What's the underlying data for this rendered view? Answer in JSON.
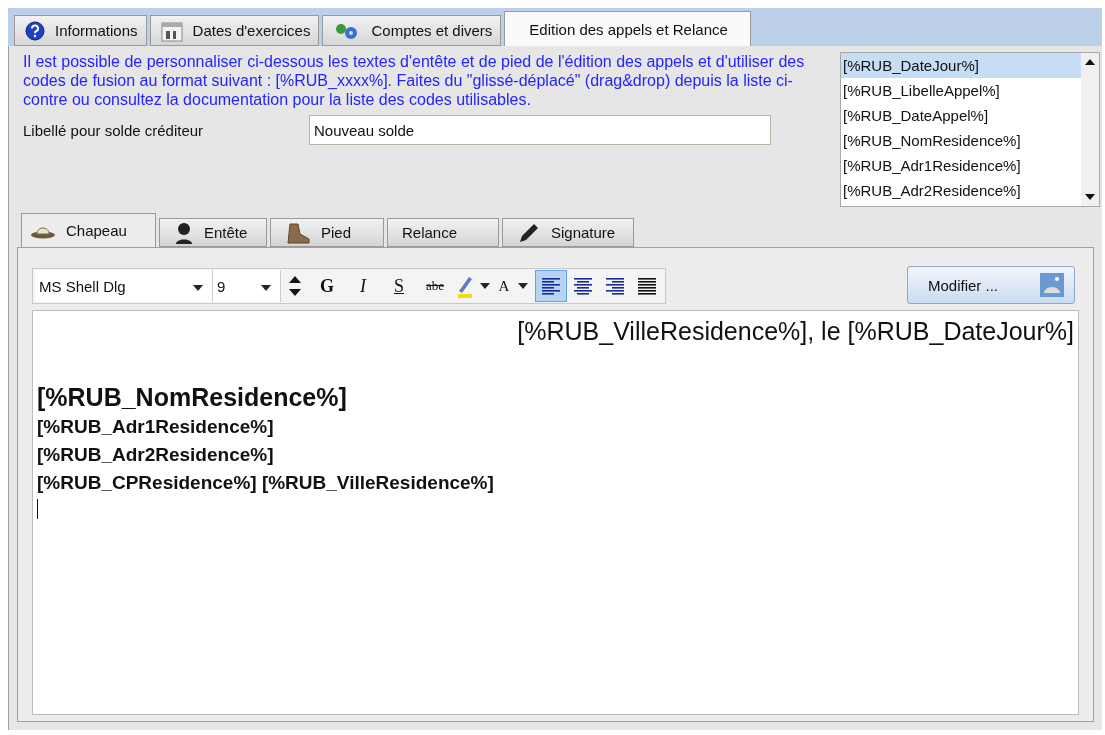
{
  "tabs": [
    {
      "label": "Informations",
      "selected": false
    },
    {
      "label": "Dates d'exercices",
      "selected": false
    },
    {
      "label": "Comptes et divers",
      "selected": false
    },
    {
      "label": "Edition des appels et Relance",
      "selected": true
    }
  ],
  "description": "Il est possible de personnaliser ci-dessous les textes d'entête et de pied de l'édition des appels et d'utiliser des codes de fusion au format suivant : [%RUB_xxxx%]. Faites du \"glissé-déplacé\" (drag&drop) depuis la liste ci-contre ou consultez la documentation pour la liste des codes utilisables.",
  "credit_label": "Libellé pour solde créditeur",
  "credit_field": {
    "value": "Nouveau solde"
  },
  "merge_codes": [
    {
      "label": "[%RUB_DateJour%]",
      "selected": true
    },
    {
      "label": "[%RUB_LibelleAppel%]",
      "selected": false
    },
    {
      "label": "[%RUB_DateAppel%]",
      "selected": false
    },
    {
      "label": "[%RUB_NomResidence%]",
      "selected": false
    },
    {
      "label": "[%RUB_Adr1Residence%]",
      "selected": false
    },
    {
      "label": "[%RUB_Adr2Residence%]",
      "selected": false
    }
  ],
  "sub_tabs": [
    {
      "label": "Chapeau",
      "selected": true
    },
    {
      "label": "Entête",
      "selected": false
    },
    {
      "label": "Pied",
      "selected": false
    },
    {
      "label": "Relance",
      "selected": false
    },
    {
      "label": "Signature",
      "selected": false
    }
  ],
  "toolbar": {
    "font": "MS Shell Dlg",
    "size": "9",
    "format_buttons": [
      {
        "label": "G",
        "kind": "bold"
      },
      {
        "label": "I",
        "kind": "italic"
      },
      {
        "label": "S",
        "kind": "underline"
      },
      {
        "label": "abe",
        "kind": "strike"
      }
    ],
    "font_color_label": "A",
    "align_buttons": [
      {
        "kind": "left",
        "selected": true
      },
      {
        "kind": "center",
        "selected": false
      },
      {
        "kind": "right",
        "selected": false
      },
      {
        "kind": "justify",
        "selected": false
      }
    ]
  },
  "modify_button": "Modifier ...",
  "editor": [
    {
      "text": "[%RUB_VilleResidence%], le [%RUB_DateJour%]",
      "kind": "date_line"
    },
    {
      "text": "[%RUB_NomResidence%]",
      "kind": "title"
    },
    {
      "text": "[%RUB_Adr1Residence%]",
      "kind": "address"
    },
    {
      "text": "[%RUB_Adr2Residence%]",
      "kind": "address"
    },
    {
      "text": "[%RUB_CPResidence%] [%RUB_VilleResidence%]",
      "kind": "address"
    }
  ]
}
